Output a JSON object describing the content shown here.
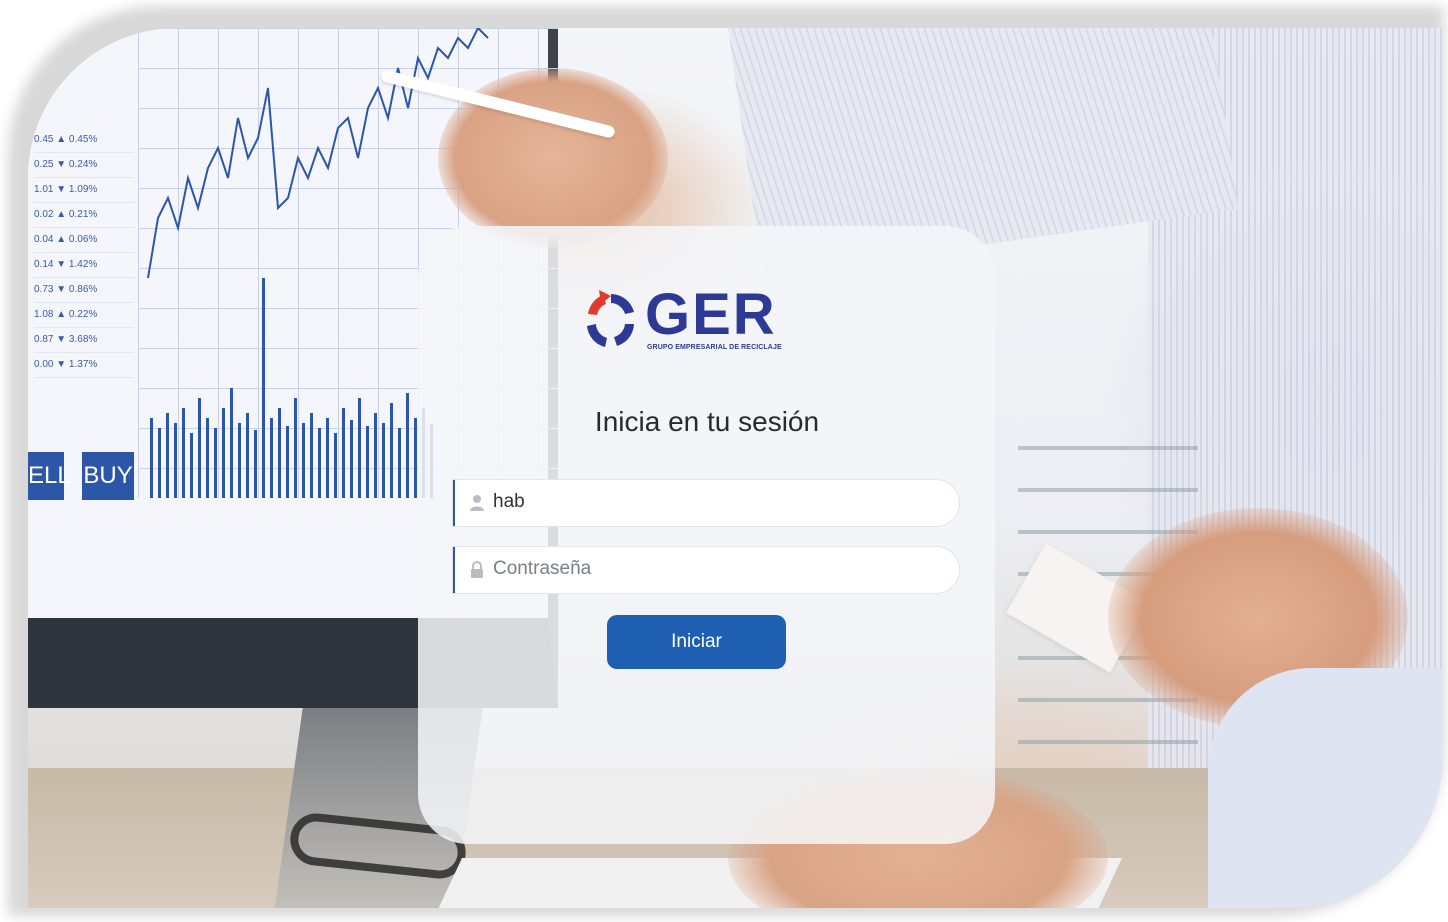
{
  "background": {
    "monitor_ticker": [
      "0.45 ▲ 0.45%",
      "0.25 ▼ 0.24%",
      "1.01 ▼ 1.09%",
      "0.02 ▲ 0.21%",
      "0.04 ▲ 0.06%",
      "0.14 ▼ 1.42%",
      "0.73 ▼ 0.86%",
      "1.08 ▲ 0.22%",
      "0.87 ▼ 3.68%",
      "0.00 ▼ 1.37%"
    ],
    "sell_label": "ELL",
    "buy_label": "BUY"
  },
  "brand": {
    "logo_name": "GER",
    "logo_subtitle": "GRUPO EMPRESARIAL DE RECICLAJE",
    "logo_icon": "recycle-ring-icon",
    "primary_color": "#2d3a95",
    "accent_color": "#e23b2e"
  },
  "login": {
    "title": "Inicia en tu sesión",
    "username": {
      "value": "hab",
      "icon": "user-icon"
    },
    "password": {
      "placeholder": "Contraseña",
      "icon": "lock-icon"
    },
    "submit_label": "Iniciar",
    "button_color": "#1f5fb2"
  }
}
